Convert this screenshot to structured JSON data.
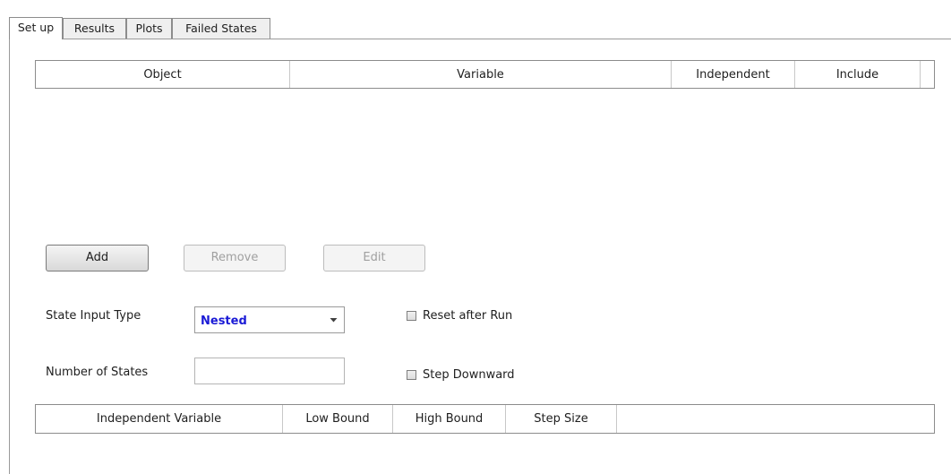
{
  "tabs": [
    {
      "label": "Set up",
      "active": true
    },
    {
      "label": "Results",
      "active": false
    },
    {
      "label": "Plots",
      "active": false
    },
    {
      "label": "Failed States",
      "active": false
    }
  ],
  "objects_table": {
    "columns": [
      "Object",
      "Variable",
      "Independent",
      "Include"
    ],
    "rows": []
  },
  "buttons": {
    "add": "Add",
    "remove": "Remove",
    "edit": "Edit"
  },
  "state_input_type": {
    "label": "State Input Type",
    "value": "Nested"
  },
  "number_of_states": {
    "label": "Number of States",
    "value": ""
  },
  "checkboxes": {
    "reset_after_run": {
      "label": "Reset after Run",
      "checked": false
    },
    "step_downward": {
      "label": "Step Downward",
      "checked": false
    }
  },
  "variables_table": {
    "columns": [
      "Independent Variable",
      "Low Bound",
      "High Bound",
      "Step Size"
    ],
    "rows": []
  },
  "colors": {
    "select_value": "#1a1ad6",
    "border": "#8c8c8c"
  }
}
